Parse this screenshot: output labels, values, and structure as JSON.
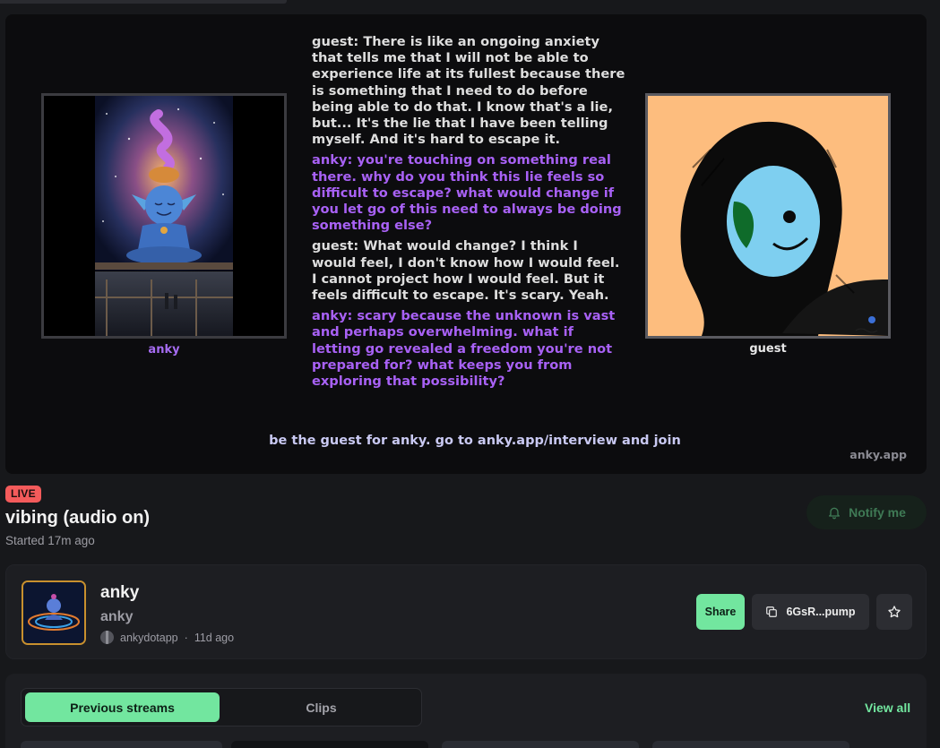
{
  "stream": {
    "left_name": "anky",
    "right_name": "guest",
    "transcript": [
      {
        "speaker": "guest",
        "text": "guest: There is like an ongoing anxiety that tells me that I will not be able to experience life at its fullest because there is something that I need to do before being able to do that. I know that's a lie, but... It's the lie that I have been telling myself. And it's hard to escape it."
      },
      {
        "speaker": "anky",
        "text": "anky: you're touching on something real there. why do you think this lie feels so difficult to escape? what would change if you let go of this need to always be doing something else?"
      },
      {
        "speaker": "guest",
        "text": "guest: What would change? I think I would feel, I don't know how I would feel. I cannot project how I would feel. But it feels difficult to escape. It's scary. Yeah."
      },
      {
        "speaker": "anky",
        "text": "anky: scary because the unknown is vast and perhaps overwhelming. what if letting go revealed a freedom you're not prepared for? what keeps you from exploring that possibility?"
      }
    ],
    "cta": "be the guest for anky. go to anky.app/interview and join",
    "watermark": "anky.app"
  },
  "meta": {
    "live_badge": "LIVE",
    "title": "vibing (audio on)",
    "started": "Started 17m ago",
    "notify_label": "Notify me"
  },
  "token": {
    "name": "anky",
    "ticker": "anky",
    "creator": "ankydotapp",
    "age": "11d ago",
    "share_label": "Share",
    "contract_label": "6GsR...pump"
  },
  "streams": {
    "tab_previous": "Previous streams",
    "tab_clips": "Clips",
    "view_all": "View all"
  },
  "colors": {
    "accent_green": "#72e69f",
    "live_red": "#f45b5b",
    "anky_purple": "#a861f5"
  }
}
